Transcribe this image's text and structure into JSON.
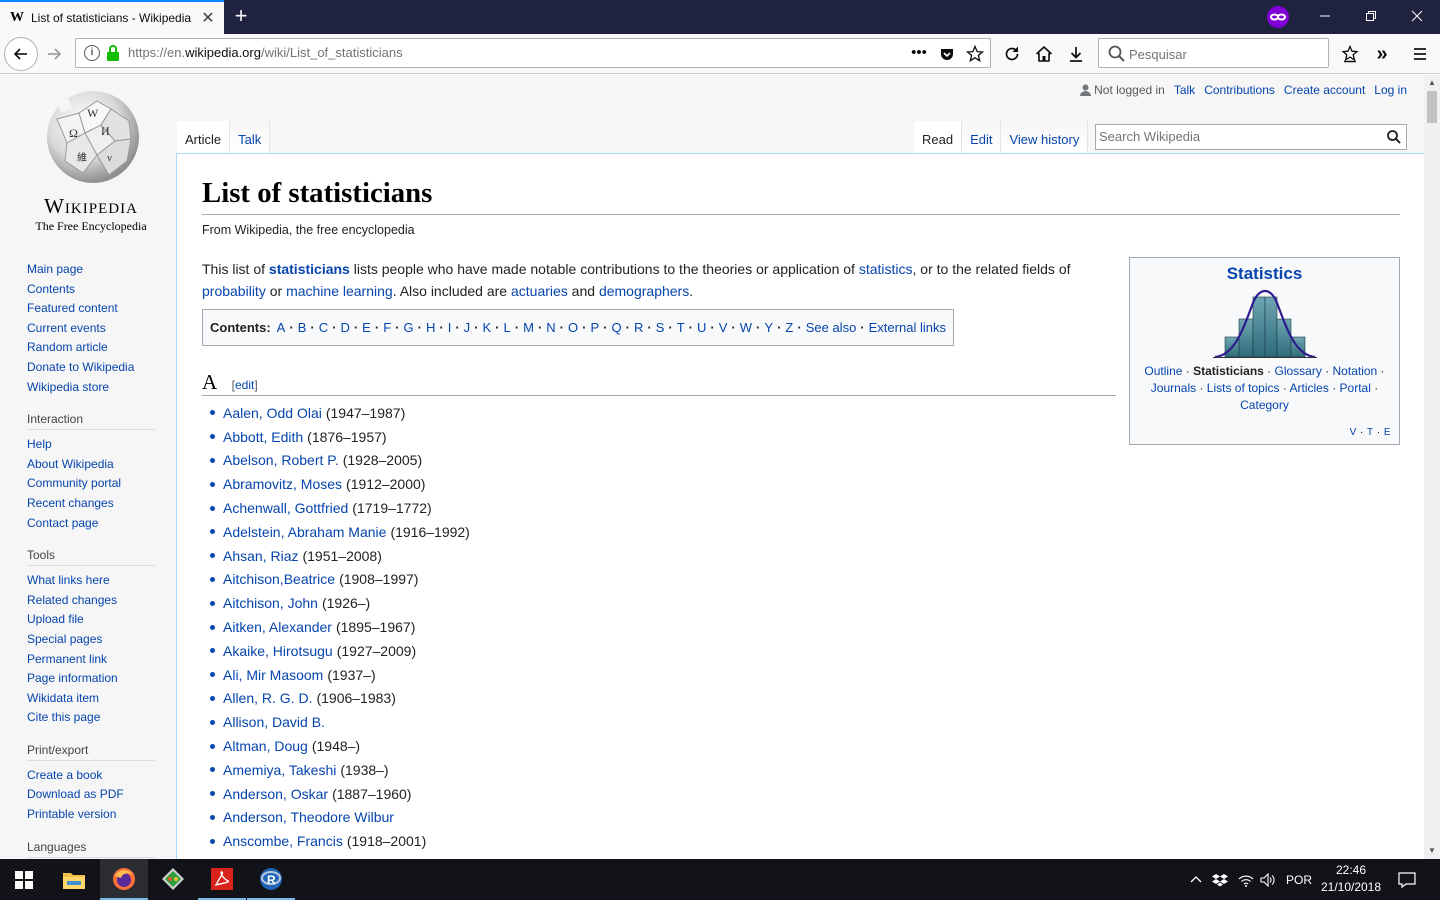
{
  "browser": {
    "tab_title": "List of statisticians - Wikipedia",
    "tab_favicon": "W",
    "new_tab": "+",
    "url_prefix": "https://en.",
    "url_domain": "wikipedia.org",
    "url_path": "/wiki/List_of_statisticians",
    "search_placeholder": "Pesquisar",
    "icons": [
      "back-icon",
      "forward-icon",
      "info-icon",
      "lock-icon",
      "more-icon",
      "pocket-icon",
      "bookmark-star-icon",
      "reload-icon",
      "home-icon",
      "download-icon",
      "search-icon",
      "bookmarks-icon",
      "overflow-icon",
      "menu-icon",
      "private-browsing-icon"
    ],
    "accent_color": "#0a84ff",
    "private_color": "#8000d7"
  },
  "wiki": {
    "logo_wordmark": "Wikipedia",
    "logo_tagline": "The Free Encyclopedia",
    "personal": {
      "not_logged_in": "Not logged in",
      "talk": "Talk",
      "contributions": "Contributions",
      "create_account": "Create account",
      "log_in": "Log in"
    },
    "tabs": {
      "article": "Article",
      "talk": "Talk",
      "read": "Read",
      "edit": "Edit",
      "history": "View history"
    },
    "search_placeholder": "Search Wikipedia",
    "sidebar": {
      "main": [
        "Main page",
        "Contents",
        "Featured content",
        "Current events",
        "Random article",
        "Donate to Wikipedia",
        "Wikipedia store"
      ],
      "interaction_heading": "Interaction",
      "interaction": [
        "Help",
        "About Wikipedia",
        "Community portal",
        "Recent changes",
        "Contact page"
      ],
      "tools_heading": "Tools",
      "tools": [
        "What links here",
        "Related changes",
        "Upload file",
        "Special pages",
        "Permanent link",
        "Page information",
        "Wikidata item",
        "Cite this page"
      ],
      "print_heading": "Print/export",
      "print": [
        "Create a book",
        "Download as PDF",
        "Printable version"
      ],
      "languages_heading": "Languages"
    },
    "article": {
      "title": "List of statisticians",
      "from": "From Wikipedia, the free encyclopedia",
      "lead": {
        "t1": "This list of ",
        "l1": "statisticians",
        "t2": " lists people who have made notable contributions to the theories or application of ",
        "l2": "statistics",
        "t3": ", or to the related fields of ",
        "l3": "probability",
        "t4": " or ",
        "l4": "machine learning",
        "t5": ". Also included are ",
        "l5": "actuaries",
        "t6": " and ",
        "l6": "demographers",
        "t7": "."
      },
      "toc_label": "Contents:",
      "toc_items": [
        "A",
        "B",
        "C",
        "D",
        "E",
        "F",
        "G",
        "H",
        "I",
        "J",
        "K",
        "L",
        "M",
        "N",
        "O",
        "P",
        "Q",
        "R",
        "S",
        "T",
        "U",
        "V",
        "W",
        "Y",
        "Z",
        "See also",
        "External links"
      ],
      "section_letter": "A",
      "section_edit": "edit",
      "people": [
        {
          "name": "Aalen, Odd Olai",
          "dates": "(1947–1987)"
        },
        {
          "name": "Abbott, Edith",
          "dates": "(1876–1957)"
        },
        {
          "name": "Abelson, Robert P.",
          "dates": "(1928–2005)"
        },
        {
          "name": "Abramovitz, Moses",
          "dates": "(1912–2000)"
        },
        {
          "name": "Achenwall, Gottfried",
          "dates": "(1719–1772)"
        },
        {
          "name": "Adelstein, Abraham Manie",
          "dates": "(1916–1992)"
        },
        {
          "name": "Ahsan, Riaz",
          "dates": "(1951–2008)"
        },
        {
          "name": "Aitchison,Beatrice",
          "dates": "(1908–1997)"
        },
        {
          "name": "Aitchison, John",
          "dates": "(1926–)"
        },
        {
          "name": "Aitken, Alexander",
          "dates": "(1895–1967)"
        },
        {
          "name": "Akaike, Hirotsugu",
          "dates": "(1927–2009)"
        },
        {
          "name": "Ali, Mir Masoom",
          "dates": "(1937–)"
        },
        {
          "name": "Allen, R. G. D.",
          "dates": "(1906–1983)"
        },
        {
          "name": "Allison, David B.",
          "dates": ""
        },
        {
          "name": "Altman, Doug",
          "dates": "(1948–)"
        },
        {
          "name": "Amemiya, Takeshi",
          "dates": "(1938–)"
        },
        {
          "name": "Anderson, Oskar",
          "dates": "(1887–1960)"
        },
        {
          "name": "Anderson, Theodore Wilbur",
          "dates": ""
        },
        {
          "name": "Anscombe, Francis",
          "dates": "(1918–2001)"
        }
      ]
    },
    "navbox": {
      "title": "Statistics",
      "outline": "Outline",
      "statisticians": "Statisticians",
      "glossary": "Glossary",
      "notation": "Notation",
      "journals": "Journals",
      "lists": "Lists of topics",
      "articles": "Articles",
      "portal": "Portal",
      "category": "Category",
      "v": "V",
      "t": "T",
      "e": "E"
    },
    "link_color": "#0645ad"
  },
  "taskbar": {
    "apps": [
      "file-explorer-icon",
      "firefox-icon",
      "git-icon",
      "acrobat-icon",
      "r-icon"
    ],
    "language": "POR",
    "time": "22:46",
    "date": "21/10/2018"
  }
}
